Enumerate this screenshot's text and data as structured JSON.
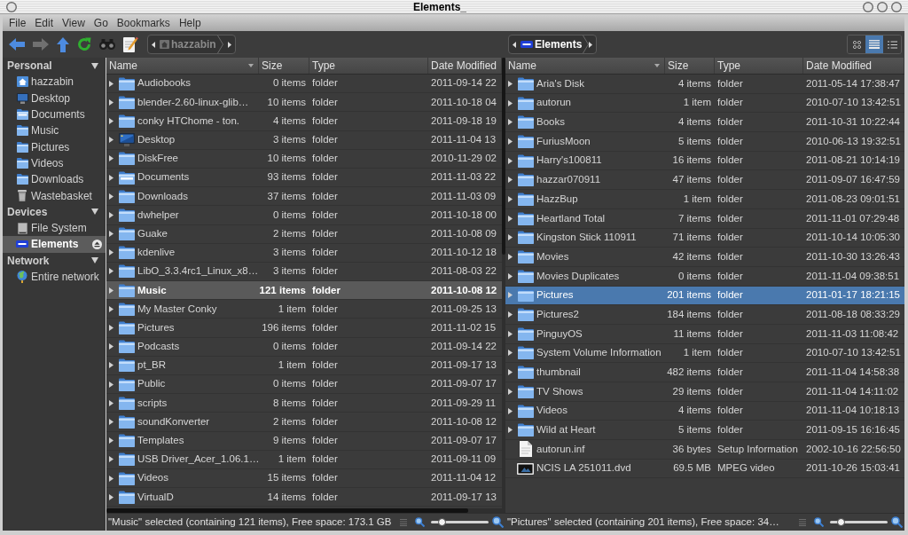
{
  "window": {
    "title": "Elements_"
  },
  "menu": [
    "File",
    "Edit",
    "View",
    "Go",
    "Bookmarks",
    "Help"
  ],
  "toolbar": {
    "buttons": [
      {
        "kind": "back",
        "disabled": false
      },
      {
        "kind": "forward",
        "disabled": true
      },
      {
        "kind": "up",
        "disabled": false
      },
      {
        "kind": "reload",
        "disabled": false
      },
      {
        "kind": "search",
        "disabled": false
      },
      {
        "kind": "edit",
        "disabled": false
      }
    ],
    "view_modes": [
      {
        "kind": "icons",
        "selected": false
      },
      {
        "kind": "list",
        "selected": true
      },
      {
        "kind": "compact",
        "selected": false
      }
    ]
  },
  "sidebar": {
    "sections": [
      {
        "title": "Personal",
        "expanded": true,
        "items": [
          {
            "label": "hazzabin",
            "kind": "home",
            "selected": false
          },
          {
            "label": "Desktop",
            "kind": "desktop",
            "selected": false
          },
          {
            "label": "Documents",
            "kind": "documents",
            "selected": false
          },
          {
            "label": "Music",
            "kind": "folder",
            "selected": false
          },
          {
            "label": "Pictures",
            "kind": "folder",
            "selected": false
          },
          {
            "label": "Videos",
            "kind": "folder",
            "selected": false
          },
          {
            "label": "Downloads",
            "kind": "folder",
            "selected": false
          },
          {
            "label": "Wastebasket",
            "kind": "trash",
            "selected": false
          }
        ]
      },
      {
        "title": "Devices",
        "expanded": true,
        "items": [
          {
            "label": "File System",
            "kind": "drive",
            "selected": false,
            "ejectable": false
          },
          {
            "label": "Elements",
            "kind": "wd-drive",
            "selected": true,
            "ejectable": true
          }
        ]
      },
      {
        "title": "Network",
        "expanded": true,
        "items": [
          {
            "label": "Entire network",
            "kind": "network",
            "selected": false
          }
        ]
      }
    ]
  },
  "panes": [
    {
      "active": false,
      "path": {
        "label": "hazzabin",
        "kind": "home"
      },
      "columns": [
        {
          "label": "Name",
          "sorted": true
        },
        {
          "label": "Size",
          "sorted": false
        },
        {
          "label": "Type",
          "sorted": false
        },
        {
          "label": "Date Modified",
          "sorted": false
        }
      ],
      "rows": [
        {
          "name": "Audiobooks",
          "size": "0 items",
          "type": "folder",
          "date": "2011-09-14 22",
          "kind": "folder",
          "selected": false
        },
        {
          "name": "blender-2.60-linux-glib…",
          "size": "10 items",
          "type": "folder",
          "date": "2011-10-18 04",
          "kind": "folder",
          "selected": false
        },
        {
          "name": "conky HTChome - ton.",
          "size": "4 items",
          "type": "folder",
          "date": "2011-09-18 19",
          "kind": "folder",
          "selected": false
        },
        {
          "name": "Desktop",
          "size": "3 items",
          "type": "folder",
          "date": "2011-11-04 13",
          "kind": "desktop",
          "selected": false
        },
        {
          "name": "DiskFree",
          "size": "10 items",
          "type": "folder",
          "date": "2010-11-29 02",
          "kind": "folder",
          "selected": false
        },
        {
          "name": "Documents",
          "size": "93 items",
          "type": "folder",
          "date": "2011-11-03 22",
          "kind": "documents",
          "selected": false
        },
        {
          "name": "Downloads",
          "size": "37 items",
          "type": "folder",
          "date": "2011-11-03 09",
          "kind": "folder",
          "selected": false
        },
        {
          "name": "dwhelper",
          "size": "0 items",
          "type": "folder",
          "date": "2011-10-18 00",
          "kind": "folder",
          "selected": false
        },
        {
          "name": "Guake",
          "size": "2 items",
          "type": "folder",
          "date": "2011-10-08 09",
          "kind": "folder",
          "selected": false
        },
        {
          "name": "kdenlive",
          "size": "3 items",
          "type": "folder",
          "date": "2011-10-12 18",
          "kind": "folder",
          "selected": false
        },
        {
          "name": "LibO_3.3.4rc1_Linux_x8…",
          "size": "3 items",
          "type": "folder",
          "date": "2011-08-03 22",
          "kind": "folder",
          "selected": false
        },
        {
          "name": "Music",
          "size": "121 items",
          "type": "folder",
          "date": "2011-10-08 12",
          "kind": "folder",
          "selected": true
        },
        {
          "name": "My Master Conky",
          "size": "1 item",
          "type": "folder",
          "date": "2011-09-25 13",
          "kind": "folder",
          "selected": false
        },
        {
          "name": "Pictures",
          "size": "196 items",
          "type": "folder",
          "date": "2011-11-02 15",
          "kind": "folder",
          "selected": false
        },
        {
          "name": "Podcasts",
          "size": "0 items",
          "type": "folder",
          "date": "2011-09-14 22",
          "kind": "folder",
          "selected": false
        },
        {
          "name": "pt_BR",
          "size": "1 item",
          "type": "folder",
          "date": "2011-09-17 13",
          "kind": "folder",
          "selected": false
        },
        {
          "name": "Public",
          "size": "0 items",
          "type": "folder",
          "date": "2011-09-07 17",
          "kind": "folder",
          "selected": false
        },
        {
          "name": "scripts",
          "size": "8 items",
          "type": "folder",
          "date": "2011-09-29 11",
          "kind": "folder",
          "selected": false
        },
        {
          "name": "soundKonverter",
          "size": "2 items",
          "type": "folder",
          "date": "2011-10-08 12",
          "kind": "folder",
          "selected": false
        },
        {
          "name": "Templates",
          "size": "9 items",
          "type": "folder",
          "date": "2011-09-07 17",
          "kind": "folder",
          "selected": false
        },
        {
          "name": "USB Driver_Acer_1.06.1…",
          "size": "1 item",
          "type": "folder",
          "date": "2011-09-11 09",
          "kind": "folder",
          "selected": false
        },
        {
          "name": "Videos",
          "size": "15 items",
          "type": "folder",
          "date": "2011-11-04 12",
          "kind": "folder",
          "selected": false
        },
        {
          "name": "VirtualD",
          "size": "14 items",
          "type": "folder",
          "date": "2011-09-17 13",
          "kind": "folder",
          "selected": false
        }
      ],
      "status": {
        "text": "\"Music\" selected (containing 121 items), Free space: 173.1 GB",
        "zoom": {
          "level": 0.15
        }
      }
    },
    {
      "active": true,
      "path": {
        "label": "Elements",
        "kind": "wd-drive"
      },
      "columns": [
        {
          "label": "Name",
          "sorted": true
        },
        {
          "label": "Size",
          "sorted": false
        },
        {
          "label": "Type",
          "sorted": false
        },
        {
          "label": "Date Modified",
          "sorted": false
        }
      ],
      "rows": [
        {
          "name": "Aria's Disk",
          "size": "4 items",
          "type": "folder",
          "date": "2011-05-14 17:38:47",
          "kind": "folder",
          "selected": false
        },
        {
          "name": "autorun",
          "size": "1 item",
          "type": "folder",
          "date": "2010-07-10 13:42:51",
          "kind": "folder",
          "selected": false
        },
        {
          "name": "Books",
          "size": "4 items",
          "type": "folder",
          "date": "2011-10-31 10:22:44",
          "kind": "folder",
          "selected": false
        },
        {
          "name": "FuriusMoon",
          "size": "5 items",
          "type": "folder",
          "date": "2010-06-13 19:32:51",
          "kind": "folder",
          "selected": false
        },
        {
          "name": "Harry's100811",
          "size": "16 items",
          "type": "folder",
          "date": "2011-08-21 10:14:19",
          "kind": "folder",
          "selected": false
        },
        {
          "name": "hazzar070911",
          "size": "47 items",
          "type": "folder",
          "date": "2011-09-07 16:47:59",
          "kind": "folder",
          "selected": false
        },
        {
          "name": "HazzBup",
          "size": "1 item",
          "type": "folder",
          "date": "2011-08-23 09:01:51",
          "kind": "folder",
          "selected": false
        },
        {
          "name": "Heartland Total",
          "size": "7 items",
          "type": "folder",
          "date": "2011-11-01 07:29:48",
          "kind": "folder",
          "selected": false
        },
        {
          "name": "Kingston Stick 110911",
          "size": "71 items",
          "type": "folder",
          "date": "2011-10-14 10:05:30",
          "kind": "folder",
          "selected": false
        },
        {
          "name": "Movies",
          "size": "42 items",
          "type": "folder",
          "date": "2011-10-30 13:26:43",
          "kind": "folder",
          "selected": false
        },
        {
          "name": "Movies Duplicates",
          "size": "0 items",
          "type": "folder",
          "date": "2011-11-04 09:38:51",
          "kind": "folder",
          "selected": false
        },
        {
          "name": "Pictures",
          "size": "201 items",
          "type": "folder",
          "date": "2011-01-17 18:21:15",
          "kind": "folder",
          "selected": true
        },
        {
          "name": "Pictures2",
          "size": "184 items",
          "type": "folder",
          "date": "2011-08-18 08:33:29",
          "kind": "folder",
          "selected": false
        },
        {
          "name": "PinguyOS",
          "size": "11 items",
          "type": "folder",
          "date": "2011-11-03 11:08:42",
          "kind": "folder",
          "selected": false
        },
        {
          "name": "System Volume Information",
          "size": "1 item",
          "type": "folder",
          "date": "2010-07-10 13:42:51",
          "kind": "folder",
          "selected": false
        },
        {
          "name": "thumbnail",
          "size": "482 items",
          "type": "folder",
          "date": "2011-11-04 14:58:38",
          "kind": "folder",
          "selected": false
        },
        {
          "name": "TV Shows",
          "size": "29 items",
          "type": "folder",
          "date": "2011-11-04 14:11:02",
          "kind": "folder",
          "selected": false
        },
        {
          "name": "Videos",
          "size": "4 items",
          "type": "folder",
          "date": "2011-11-04 10:18:13",
          "kind": "folder",
          "selected": false
        },
        {
          "name": "Wild at Heart",
          "size": "5 items",
          "type": "folder",
          "date": "2011-09-15 16:16:45",
          "kind": "folder",
          "selected": false
        },
        {
          "name": "autorun.inf",
          "size": "36 bytes",
          "type": "Setup Information",
          "date": "2002-10-16 22:56:50",
          "kind": "text-file",
          "selected": false
        },
        {
          "name": "NCIS LA 251011.dvd",
          "size": "69.5 MB",
          "type": "MPEG video",
          "date": "2011-10-26 15:03:41",
          "kind": "video-file",
          "selected": false
        }
      ],
      "status": {
        "text": "\"Pictures\" selected (containing 201 items), Free space: 34…",
        "zoom": {
          "level": 0.15
        }
      }
    }
  ]
}
